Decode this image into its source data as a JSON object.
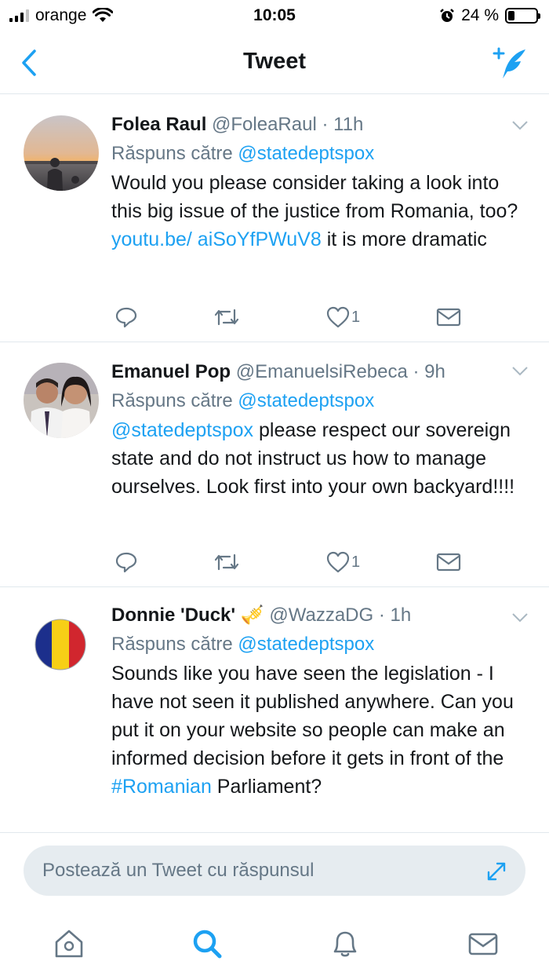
{
  "status": {
    "carrier": "orange",
    "time": "10:05",
    "battery": "24 %",
    "battery_level": 0.24,
    "signal_bars": 3
  },
  "nav": {
    "title": "Tweet",
    "back_icon": "chevron-left-icon",
    "compose_icon": "compose-tweet-icon"
  },
  "tweets": [
    {
      "name": "Folea Raul",
      "handle": "@FoleaRaul",
      "time": "· 11h",
      "reply_prefix": "Răspuns către",
      "reply_to": "@statedeptspox",
      "text_a": "Would you please consider taking a look into this big issue of the justice from Romania, too? ",
      "link": "youtu.be/ aiSoYfPWuV8",
      "text_b": " it is more dramatic",
      "likes": "1",
      "avatar": "sunset-photo"
    },
    {
      "name": "Emanuel Pop",
      "handle": "@EmanuelsiRebeca",
      "time": "· 9h",
      "reply_prefix": "Răspuns către",
      "reply_to": "@statedeptspox",
      "mention": "@statedeptspox",
      "text": " please respect our sovereign state and do not instruct us how to manage ourselves. Look first into your own backyard!!!!",
      "likes": "1",
      "avatar": "couple-photo"
    },
    {
      "name": "Donnie 'Duck'",
      "name_emoji": "🎺",
      "handle": "@WazzaDG",
      "time": "· 1h",
      "reply_prefix": "Răspuns către",
      "reply_to": "@statedeptspox",
      "text_a": "Sounds like you have seen the legislation - I have not seen it published anywhere. Can you put it on your website so people can make an informed decision before it gets in front of the ",
      "hashtag": "#Romanian",
      "text_b": " Parliament?",
      "avatar": "romania-flag"
    }
  ],
  "reply_bar": {
    "placeholder": "Postează un Tweet cu răspunsul"
  },
  "colors": {
    "accent": "#1da1f2",
    "muted": "#657786",
    "text": "#14171a",
    "divider": "#e1e8ed",
    "input_bg": "#e6ecf0"
  },
  "tabs": [
    "home-icon",
    "search-icon",
    "notifications-icon",
    "messages-icon"
  ]
}
